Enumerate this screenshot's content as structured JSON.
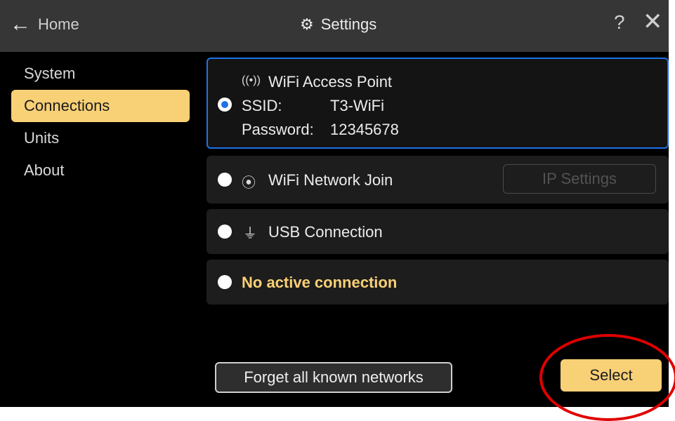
{
  "header": {
    "back_label": "Home",
    "title": "Settings",
    "help_label": "?"
  },
  "sidebar": {
    "items": [
      {
        "label": "System"
      },
      {
        "label": "Connections",
        "active": true
      },
      {
        "label": "Units"
      },
      {
        "label": "About"
      }
    ]
  },
  "connections": {
    "access_point": {
      "title": "WiFi Access Point",
      "ssid_label": "SSID:",
      "ssid_value": "T3-WiFi",
      "password_label": "Password:",
      "password_value": "12345678",
      "selected": true
    },
    "network_join": {
      "title": "WiFi Network Join",
      "ip_settings_label": "IP Settings",
      "ip_settings_enabled": false
    },
    "usb": {
      "title": "USB Connection"
    },
    "none": {
      "title": "No active connection"
    }
  },
  "footer": {
    "forget_label": "Forget all known networks",
    "select_label": "Select"
  },
  "colors": {
    "accent": "#f8d076",
    "selected_border": "#1e72e8",
    "annotation": "#e00000"
  },
  "icons": {
    "back": "left-arrow-icon",
    "settings": "gear-icon",
    "help": "question-icon",
    "close": "close-icon",
    "access_point": "antenna-icon",
    "wifi": "wifi-icon",
    "usb": "usb-plug-icon"
  }
}
